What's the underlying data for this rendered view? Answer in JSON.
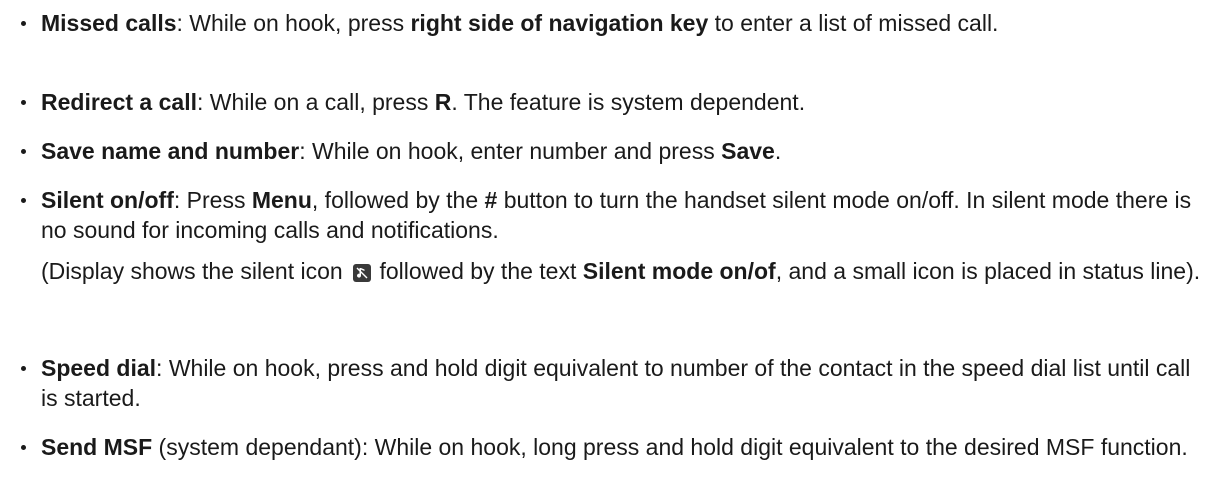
{
  "items": [
    {
      "term": "Missed calls",
      "t1": ": While on hook, press ",
      "b1": "right side of navigation key",
      "t2": " to enter a list of missed call."
    },
    {
      "term": "Redirect a call",
      "t1": ": While on a call, press ",
      "b1": "R",
      "t2": ". The feature is system dependent."
    },
    {
      "term": "Save name and number",
      "t1": ": While on hook, enter number and press ",
      "b1": "Save",
      "t2": "."
    },
    {
      "term": "Silent on/off",
      "t1": ": Press ",
      "b1": "Menu",
      "t2": ", followed by the ",
      "b2": "#",
      "t3": " button to turn the handset silent mode on/off. In silent mode there is no sound for incoming calls and notifications.",
      "note": {
        "t1": "(Display shows the silent icon ",
        "icon": "silent-icon",
        "t2": " followed by the text ",
        "b1": "Silent mode on/of",
        "t3": ", and a small icon is placed in status line)."
      }
    },
    {
      "term": "Speed dial",
      "t1": ": While on hook, press and hold digit equivalent to number of the contact in the speed dial list until call is started."
    },
    {
      "term": "Send MSF",
      "t1": " (system dependant): While on hook, long press and hold digit equivalent to the desired MSF function."
    }
  ]
}
